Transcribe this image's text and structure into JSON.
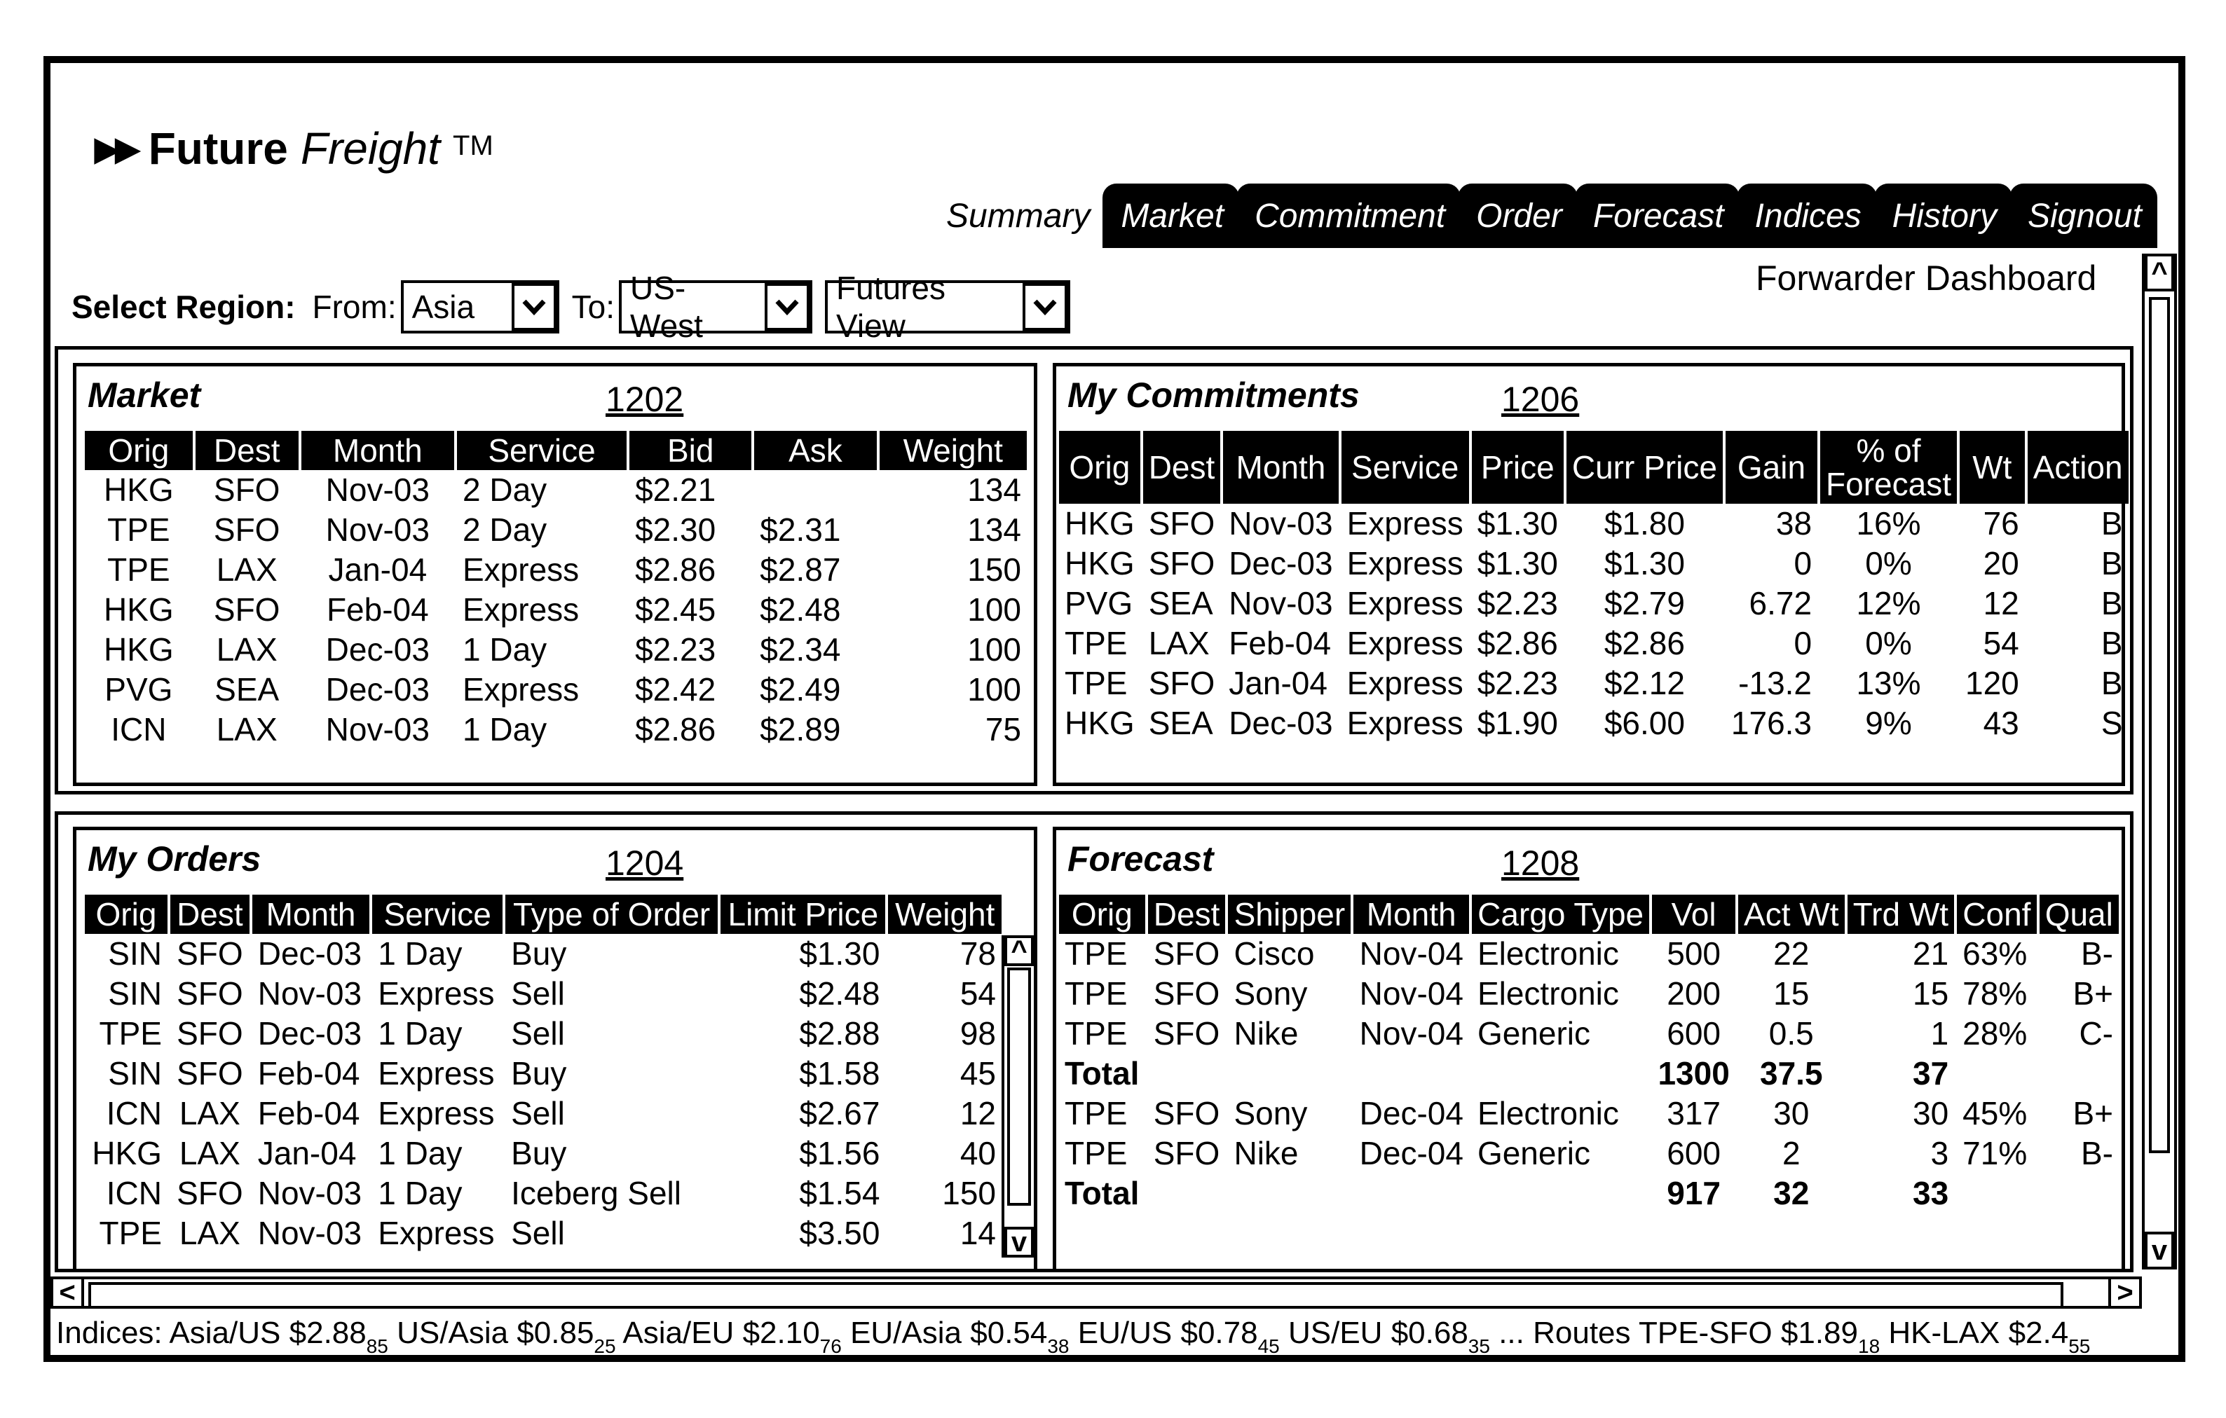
{
  "app": {
    "logo_icon": "double-play-arrows-icon",
    "title_bold": "Future",
    "title_italic": "Freight",
    "trademark": "TM",
    "subtitle": "Forwarder Dashboard"
  },
  "tabs": [
    {
      "label": "Summary",
      "active": true
    },
    {
      "label": "Market",
      "active": false
    },
    {
      "label": "Commitment",
      "active": false
    },
    {
      "label": "Order",
      "active": false
    },
    {
      "label": "Forecast",
      "active": false
    },
    {
      "label": "Indices",
      "active": false
    },
    {
      "label": "History",
      "active": false
    },
    {
      "label": "Signout",
      "active": false
    }
  ],
  "region": {
    "label": "Select Region:",
    "from_label": "From:",
    "from_value": "Asia",
    "to_label": "To:",
    "to_value": "US-West",
    "view_value": "Futures View",
    "dropdown_icon": "chevron-down-icon"
  },
  "market": {
    "title": "Market",
    "ref": "1202",
    "columns": [
      "Orig",
      "Dest",
      "Month",
      "Service",
      "Bid",
      "Ask",
      "Weight"
    ],
    "rows": [
      [
        "HKG",
        "SFO",
        "Nov-03",
        "2 Day",
        "$2.21",
        "",
        "134"
      ],
      [
        "TPE",
        "SFO",
        "Nov-03",
        "2 Day",
        "$2.30",
        "$2.31",
        "134"
      ],
      [
        "TPE",
        "LAX",
        "Jan-04",
        "Express",
        "$2.86",
        "$2.87",
        "150"
      ],
      [
        "HKG",
        "SFO",
        "Feb-04",
        "Express",
        "$2.45",
        "$2.48",
        "100"
      ],
      [
        "HKG",
        "LAX",
        "Dec-03",
        "1 Day",
        "$2.23",
        "$2.34",
        "100"
      ],
      [
        "PVG",
        "SEA",
        "Dec-03",
        "Express",
        "$2.42",
        "$2.49",
        "100"
      ],
      [
        "ICN",
        "LAX",
        "Nov-03",
        "1 Day",
        "$2.86",
        "$2.89",
        "75"
      ]
    ]
  },
  "commitments": {
    "title": "My Commitments",
    "ref": "1206",
    "columns": [
      "Orig",
      "Dest",
      "Month",
      "Service",
      "Price",
      "Curr Price",
      "Gain",
      "% of Forecast",
      "Wt",
      "Action"
    ],
    "rows": [
      [
        "HKG",
        "SFO",
        "Nov-03",
        "Express",
        "$1.30",
        "$1.80",
        "38",
        "16%",
        "76",
        "B"
      ],
      [
        "HKG",
        "SFO",
        "Dec-03",
        "Express",
        "$1.30",
        "$1.30",
        "0",
        "0%",
        "20",
        "B"
      ],
      [
        "PVG",
        "SEA",
        "Nov-03",
        "Express",
        "$2.23",
        "$2.79",
        "6.72",
        "12%",
        "12",
        "B"
      ],
      [
        "TPE",
        "LAX",
        "Feb-04",
        "Express",
        "$2.86",
        "$2.86",
        "0",
        "0%",
        "54",
        "B"
      ],
      [
        "TPE",
        "SFO",
        "Jan-04",
        "Express",
        "$2.23",
        "$2.12",
        "-13.2",
        "13%",
        "120",
        "B"
      ],
      [
        "HKG",
        "SEA",
        "Dec-03",
        "Express",
        "$1.90",
        "$6.00",
        "176.3",
        "9%",
        "43",
        "S"
      ]
    ]
  },
  "orders": {
    "title": "My Orders",
    "ref": "1204",
    "columns": [
      "Orig",
      "Dest",
      "Month",
      "Service",
      "Type of Order",
      "Limit Price",
      "Weight"
    ],
    "rows": [
      [
        "SIN",
        "SFO",
        "Dec-03",
        "1 Day",
        "Buy",
        "$1.30",
        "78"
      ],
      [
        "SIN",
        "SFO",
        "Nov-03",
        "Express",
        "Sell",
        "$2.48",
        "54"
      ],
      [
        "TPE",
        "SFO",
        "Dec-03",
        "1 Day",
        "Sell",
        "$2.88",
        "98"
      ],
      [
        "SIN",
        "SFO",
        "Feb-04",
        "Express",
        "Buy",
        "$1.58",
        "45"
      ],
      [
        "ICN",
        "LAX",
        "Feb-04",
        "Express",
        "Sell",
        "$2.67",
        "12"
      ],
      [
        "HKG",
        "LAX",
        "Jan-04",
        "1 Day",
        "Buy",
        "$1.56",
        "40"
      ],
      [
        "ICN",
        "SFO",
        "Nov-03",
        "1 Day",
        "Iceberg Sell",
        "$1.54",
        "150"
      ],
      [
        "TPE",
        "LAX",
        "Nov-03",
        "Express",
        "Sell",
        "$3.50",
        "14"
      ]
    ]
  },
  "forecast": {
    "title": "Forecast",
    "ref": "1208",
    "columns": [
      "Orig",
      "Dest",
      "Shipper",
      "Month",
      "Cargo Type",
      "Vol",
      "Act Wt",
      "Trd Wt",
      "Conf",
      "Qual"
    ],
    "rows": [
      {
        "type": "data",
        "cells": [
          "TPE",
          "SFO",
          "Cisco",
          "Nov-04",
          "Electronic",
          "500",
          "22",
          "21",
          "63%",
          "B-"
        ]
      },
      {
        "type": "data",
        "cells": [
          "TPE",
          "SFO",
          "Sony",
          "Nov-04",
          "Electronic",
          "200",
          "15",
          "15",
          "78%",
          "B+"
        ]
      },
      {
        "type": "data",
        "cells": [
          "TPE",
          "SFO",
          "Nike",
          "Nov-04",
          "Generic",
          "600",
          "0.5",
          "1",
          "28%",
          "C-"
        ]
      },
      {
        "type": "total",
        "cells": [
          "Total",
          "",
          "",
          "",
          "",
          "1300",
          "37.5",
          "37",
          "",
          ""
        ]
      },
      {
        "type": "data",
        "cells": [
          "TPE",
          "SFO",
          "Sony",
          "Dec-04",
          "Electronic",
          "317",
          "30",
          "30",
          "45%",
          "B+"
        ]
      },
      {
        "type": "data",
        "cells": [
          "TPE",
          "SFO",
          "Nike",
          "Dec-04",
          "Generic",
          "600",
          "2",
          "3",
          "71%",
          "B-"
        ]
      },
      {
        "type": "total",
        "cells": [
          "Total",
          "",
          "",
          "",
          "",
          "917",
          "32",
          "33",
          "",
          ""
        ]
      }
    ]
  },
  "indices": {
    "label": "Indices:",
    "items": [
      {
        "name": "Asia/US",
        "value": "$2.88",
        "sub": "85"
      },
      {
        "name": "US/Asia",
        "value": "$0.85",
        "sub": "25"
      },
      {
        "name": "Asia/EU",
        "value": "$2.10",
        "sub": "76"
      },
      {
        "name": "EU/Asia",
        "value": "$0.54",
        "sub": "38"
      },
      {
        "name": "EU/US",
        "value": "$0.78",
        "sub": "45"
      },
      {
        "name": "US/EU",
        "value": "$0.68",
        "sub": "35"
      }
    ],
    "ellipsis": "...",
    "routes_label": "Routes",
    "routes": [
      {
        "name": "TPE-SFO",
        "value": "$1.89",
        "sub": "18"
      },
      {
        "name": "HK-LAX",
        "value": "$2.4",
        "sub": "55"
      }
    ]
  },
  "scroll_icons": {
    "up": "^",
    "down": "v",
    "left": "<",
    "right": ">"
  }
}
